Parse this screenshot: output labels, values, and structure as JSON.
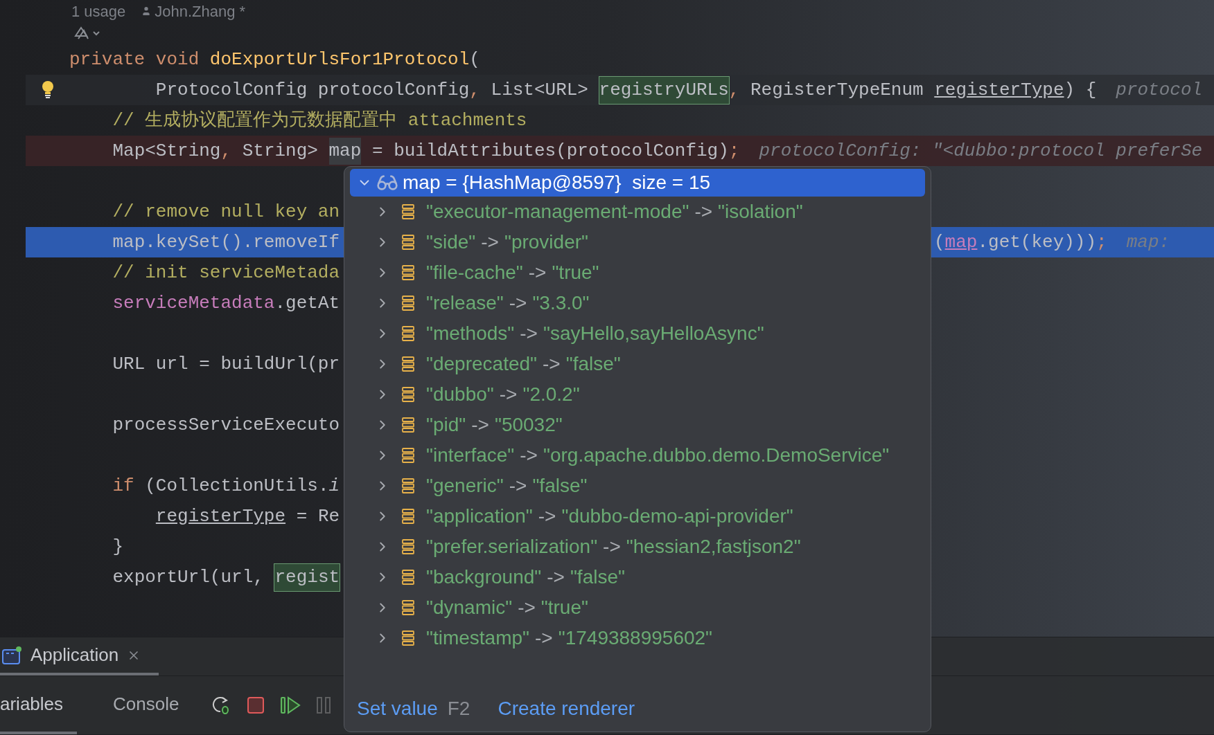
{
  "editor": {
    "usages": "1 usage",
    "author": "John.Zhang *",
    "lines": [
      {
        "kind": "plain",
        "segments": [
          {
            "kind": "keyword",
            "text": "private void "
          },
          {
            "kind": "method",
            "text": "doExportUrlsFor1Protocol"
          },
          {
            "kind": "text",
            "text": "("
          }
        ]
      },
      {
        "kind": "caret",
        "intention_bulb": true,
        "segments": [
          {
            "kind": "text",
            "text": "        ProtocolConfig protocolConfig"
          },
          {
            "kind": "punct",
            "text": ","
          },
          {
            "kind": "text",
            "text": " List<URL> "
          },
          {
            "kind": "match",
            "text": "registryURLs"
          },
          {
            "kind": "punct",
            "text": ","
          },
          {
            "kind": "text",
            "text": " RegisterTypeEnum "
          },
          {
            "kind": "param",
            "text": "registerType"
          },
          {
            "kind": "text",
            "text": ") {"
          },
          {
            "kind": "hint",
            "text": "protocol"
          }
        ]
      },
      {
        "kind": "plain",
        "segments": [
          {
            "kind": "comment",
            "text": "    // 生成协议配置作为元数据配置中 attachments"
          }
        ]
      },
      {
        "kind": "breakpoint",
        "segments": [
          {
            "kind": "text",
            "text": "    Map<String"
          },
          {
            "kind": "punct",
            "text": ","
          },
          {
            "kind": "text",
            "text": " String> "
          },
          {
            "kind": "ident",
            "text": "map"
          },
          {
            "kind": "text",
            "text": " = buildAttributes(protocolConfig)"
          },
          {
            "kind": "punct",
            "text": ";"
          },
          {
            "kind": "hint",
            "text": "protocolConfig: \"<dubbo:protocol preferSe"
          }
        ]
      },
      {
        "kind": "plain"
      },
      {
        "kind": "plain",
        "segments": [
          {
            "kind": "comment",
            "text": "    // remove null key an"
          }
        ]
      },
      {
        "kind": "execution",
        "segments": [
          {
            "kind": "text",
            "text": "    map.keySet().removeIf"
          }
        ],
        "right_segments": [
          {
            "kind": "text",
            "text": "("
          },
          {
            "kind": "field_ref",
            "text": "map"
          },
          {
            "kind": "text",
            "text": ".get(key)))"
          },
          {
            "kind": "punct",
            "text": ";"
          },
          {
            "kind": "hint",
            "text": "map:"
          }
        ]
      },
      {
        "kind": "plain",
        "segments": [
          {
            "kind": "comment",
            "text": "    // init serviceMetada"
          }
        ]
      },
      {
        "kind": "plain",
        "segments": [
          {
            "kind": "field",
            "text": "    serviceMetadata"
          },
          {
            "kind": "text",
            "text": ".getAt"
          }
        ]
      },
      {
        "kind": "plain"
      },
      {
        "kind": "plain",
        "segments": [
          {
            "kind": "text",
            "text": "    URL url = buildUrl(pr"
          }
        ]
      },
      {
        "kind": "plain"
      },
      {
        "kind": "plain",
        "segments": [
          {
            "kind": "text",
            "text": "    processServiceExecuto"
          }
        ]
      },
      {
        "kind": "plain"
      },
      {
        "kind": "plain",
        "segments": [
          {
            "kind": "keyword",
            "text": "    if "
          },
          {
            "kind": "text",
            "text": "(CollectionUtils."
          },
          {
            "kind": "static",
            "text": "i"
          }
        ]
      },
      {
        "kind": "plain",
        "segments": [
          {
            "kind": "param",
            "text": "        registerType"
          },
          {
            "kind": "text",
            "text": " = Re"
          }
        ]
      },
      {
        "kind": "plain",
        "segments": [
          {
            "kind": "text",
            "text": "    }"
          }
        ]
      },
      {
        "kind": "plain",
        "segments": [
          {
            "kind": "text",
            "text": "    exportUrl(url, "
          },
          {
            "kind": "match",
            "text": "regist"
          }
        ]
      }
    ]
  },
  "popup": {
    "header": {
      "text": "map = {HashMap@8597}  size = 15",
      "expanded": true,
      "selected": true
    },
    "rows": [
      {
        "key": "\"executor-management-mode\"",
        "arrow": "->",
        "value": "\"isolation\"",
        "expanded": false
      },
      {
        "key": "\"side\"",
        "arrow": "->",
        "value": "\"provider\"",
        "expanded": false
      },
      {
        "key": "\"file-cache\"",
        "arrow": "->",
        "value": "\"true\"",
        "expanded": false
      },
      {
        "key": "\"release\"",
        "arrow": "->",
        "value": "\"3.3.0\"",
        "expanded": false
      },
      {
        "key": "\"methods\"",
        "arrow": "->",
        "value": "\"sayHello,sayHelloAsync\"",
        "expanded": false
      },
      {
        "key": "\"deprecated\"",
        "arrow": "->",
        "value": "\"false\"",
        "expanded": false
      },
      {
        "key": "\"dubbo\"",
        "arrow": "->",
        "value": "\"2.0.2\"",
        "expanded": false
      },
      {
        "key": "\"pid\"",
        "arrow": "->",
        "value": "\"50032\"",
        "expanded": false
      },
      {
        "key": "\"interface\"",
        "arrow": "->",
        "value": "\"org.apache.dubbo.demo.DemoService\"",
        "expanded": false
      },
      {
        "key": "\"generic\"",
        "arrow": "->",
        "value": "\"false\"",
        "expanded": false
      },
      {
        "key": "\"application\"",
        "arrow": "->",
        "value": "\"dubbo-demo-api-provider\"",
        "expanded": false
      },
      {
        "key": "\"prefer.serialization\"",
        "arrow": "->",
        "value": "\"hessian2,fastjson2\"",
        "expanded": false
      },
      {
        "key": "\"background\"",
        "arrow": "->",
        "value": "\"false\"",
        "expanded": false
      },
      {
        "key": "\"dynamic\"",
        "arrow": "->",
        "value": "\"true\"",
        "expanded": false
      },
      {
        "key": "\"timestamp\"",
        "arrow": "->",
        "value": "\"1749388995602\"",
        "expanded": false
      }
    ],
    "footer": {
      "set_value": "Set value",
      "shortcut": "F2",
      "create_renderer": "Create renderer"
    }
  },
  "debug_panel": {
    "run_tab": {
      "label": "Application",
      "selected": true
    },
    "tabs": [
      {
        "label": "ariables",
        "selected": true
      },
      {
        "label": "Console",
        "selected": false
      }
    ],
    "toolbar": [
      {
        "kind": "rerun",
        "disabled": false
      },
      {
        "kind": "stop",
        "disabled": false
      },
      {
        "kind": "resume",
        "disabled": false
      },
      {
        "kind": "pause",
        "disabled": true
      }
    ]
  }
}
